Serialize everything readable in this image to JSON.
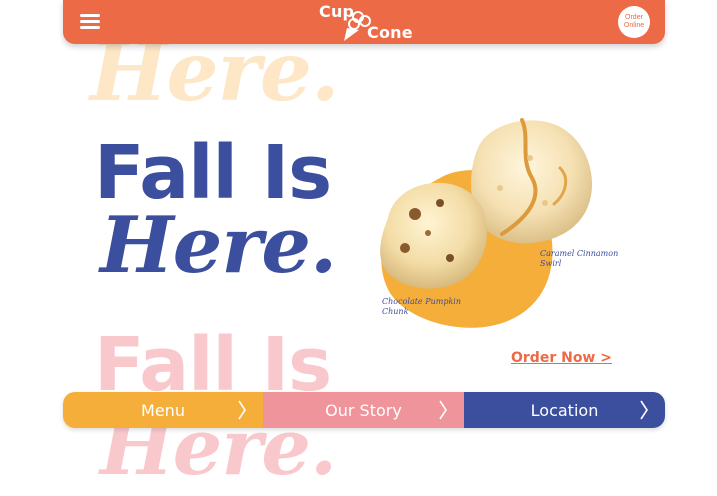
{
  "header": {
    "logo_word_1": "Cup",
    "logo_word_2": "Cone",
    "order_online_line1": "Order",
    "order_online_line2": "Online"
  },
  "hero": {
    "faded_top_text": "Here.",
    "headline_line1": "Fall Is",
    "headline_line2": "Here.",
    "faded_bottom_line1": "Fall Is",
    "faded_bottom_line2": "Here."
  },
  "flavors": {
    "caption_caramel": "Caramel Cinnamon Swirl",
    "caption_pumpkin": "Chocolate Pumpkin Chunk"
  },
  "cta": {
    "order_now": "Order Now >"
  },
  "bottom_nav": {
    "items": [
      {
        "label": "Menu"
      },
      {
        "label": "Our Story"
      },
      {
        "label": "Location"
      }
    ]
  },
  "colors": {
    "brand_orange": "#ec6a45",
    "navy": "#3c4e9e",
    "menu_yellow": "#f6ae3a",
    "story_pink": "#ee949a",
    "location_blue": "#3c4e9e",
    "blob_yellow": "#f6ae3a"
  },
  "icons": [
    "hamburger-menu-icon",
    "ice-cream-cone-logo-icon",
    "chevron-right-icon"
  ]
}
